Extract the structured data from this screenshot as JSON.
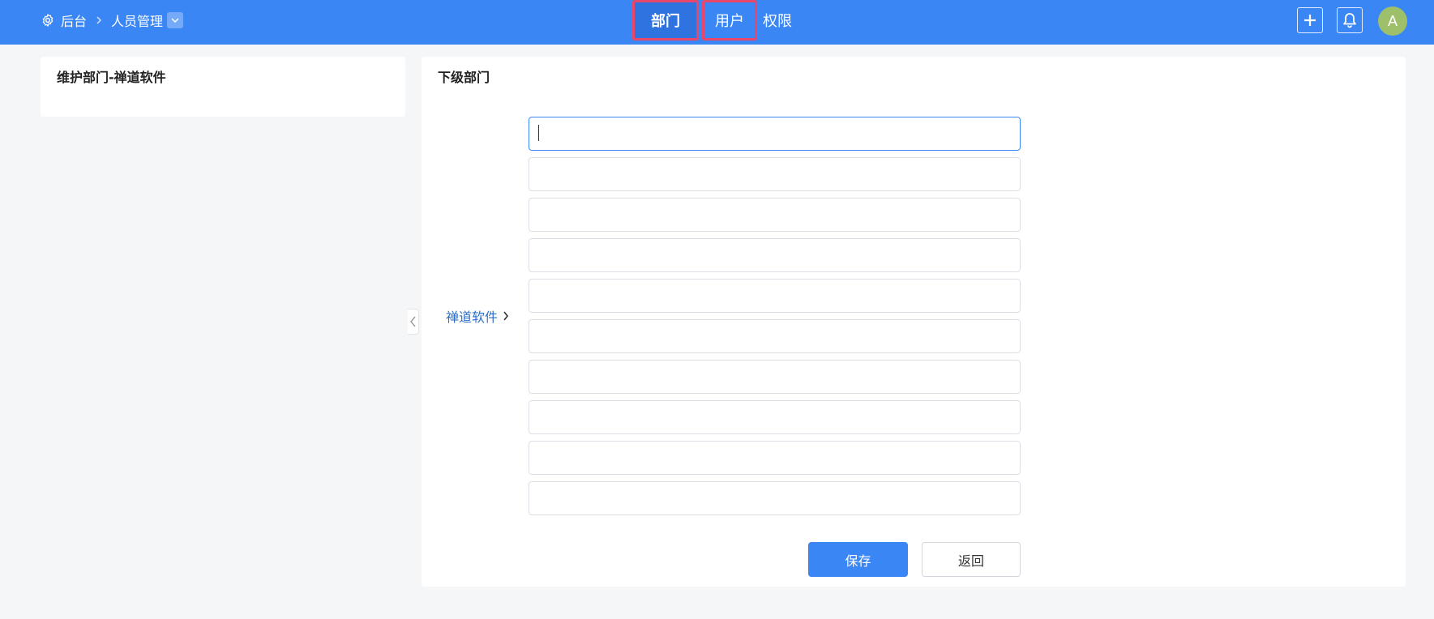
{
  "header": {
    "breadcrumb": [
      "后台",
      "人员管理"
    ],
    "tabs": [
      {
        "label": "部门",
        "active": true
      },
      {
        "label": "用户",
        "active": false
      },
      {
        "label": "权限",
        "active": false
      }
    ],
    "avatar_initial": "A",
    "icons": [
      "gear-icon",
      "chevron-right-icon",
      "chevron-down-icon",
      "plus-icon",
      "bell-icon"
    ]
  },
  "left_panel": {
    "title": "维护部门-禅道软件"
  },
  "right_panel": {
    "title": "下级部门",
    "parent_link": "禅道软件",
    "fields": [
      "",
      "",
      "",
      "",
      "",
      "",
      "",
      "",
      "",
      ""
    ],
    "save_label": "保存",
    "back_label": "返回"
  },
  "colors": {
    "accent": "#3a86f5",
    "tab_highlight": "#e8476a",
    "link": "#2b6fc9",
    "avatar": "#9fc06a"
  }
}
